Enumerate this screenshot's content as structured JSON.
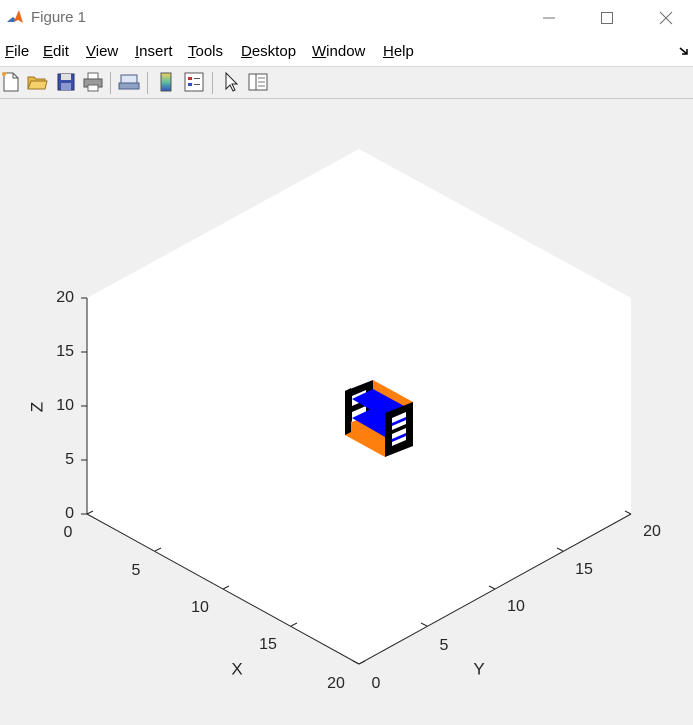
{
  "window": {
    "title": "Figure 1"
  },
  "menu": {
    "items": [
      {
        "label": "File",
        "key": "F",
        "rest": "ile"
      },
      {
        "label": "Edit",
        "key": "E",
        "rest": "dit"
      },
      {
        "label": "View",
        "key": "V",
        "rest": "iew"
      },
      {
        "label": "Insert",
        "key": "I",
        "rest": "nsert"
      },
      {
        "label": "Tools",
        "key": "T",
        "rest": "ools"
      },
      {
        "label": "Desktop",
        "key": "D",
        "rest": "esktop"
      },
      {
        "label": "Window",
        "key": "W",
        "rest": "indow"
      },
      {
        "label": "Help",
        "key": "H",
        "rest": "elp"
      }
    ]
  },
  "toolbar": {
    "buttons": [
      "new-figure-icon",
      "open-file-icon",
      "save-icon",
      "print-icon",
      "link-plot-icon",
      "colorbar-icon",
      "legend-icon",
      "edit-plot-arrow-icon",
      "property-inspector-icon"
    ]
  },
  "plot": {
    "x_ticks": [
      "0",
      "5",
      "10",
      "15",
      "20"
    ],
    "y_ticks": [
      "0",
      "5",
      "10",
      "15",
      "20"
    ],
    "z_ticks": [
      "0",
      "5",
      "10",
      "15",
      "20"
    ],
    "x_label": "X",
    "y_label": "Y",
    "z_label": "Z"
  },
  "colors": {
    "orange": "#ff7f0e",
    "blue": "#0000ff",
    "black": "#000000",
    "accent": "#d95319"
  }
}
